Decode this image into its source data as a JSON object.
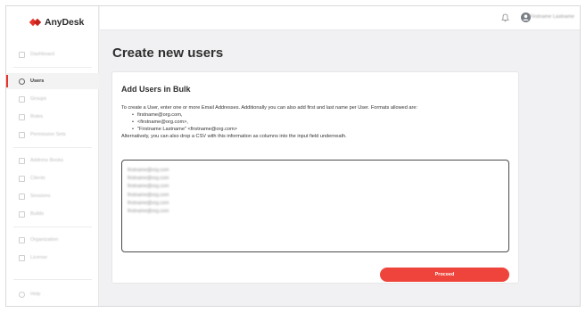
{
  "app": {
    "brand": "AnyDesk",
    "brand_color": "#e8322a"
  },
  "sidebar": {
    "items": [
      {
        "label": "Dashboard",
        "icon": "dashboard-icon",
        "active": false
      },
      {
        "label": "Users",
        "icon": "user-icon",
        "active": true
      },
      {
        "label": "Groups",
        "icon": "group-icon",
        "active": false
      },
      {
        "label": "Roles",
        "icon": "roles-icon",
        "active": false
      },
      {
        "label": "Permission Sets",
        "icon": "permission-icon",
        "active": false
      },
      {
        "label": "Address Books",
        "icon": "address-book-icon",
        "active": false
      },
      {
        "label": "Clients",
        "icon": "clients-icon",
        "active": false
      },
      {
        "label": "Sessions",
        "icon": "sessions-icon",
        "active": false
      },
      {
        "label": "Builds",
        "icon": "builds-icon",
        "active": false
      },
      {
        "label": "Organization",
        "icon": "organization-icon",
        "active": false
      },
      {
        "label": "License",
        "icon": "license-icon",
        "active": false
      },
      {
        "label": "Help",
        "icon": "help-icon",
        "active": false
      }
    ]
  },
  "header": {
    "user_name": "Firstname Lastname"
  },
  "main": {
    "title": "Create new users",
    "card": {
      "title": "Add Users in Bulk",
      "intro": "To create a User, enter one or more Email Addresses. Additionally you can also add first and last name per User. Formats allowed are:",
      "formats": [
        "firstname@org.com,",
        "<firstname@org.com>,",
        "\"Firstname Lastname\" <firstname@org.com>"
      ],
      "csv_note": "Alternatively, you can also drop a CSV with this information as columns into the input field underneath.",
      "input_lines": [
        "firstname@org.com",
        "firstname@org.com",
        "firstname@org.com",
        "firstname@org.com",
        "firstname@org.com",
        "firstname@org.com"
      ],
      "proceed_label": "Proceed"
    }
  }
}
